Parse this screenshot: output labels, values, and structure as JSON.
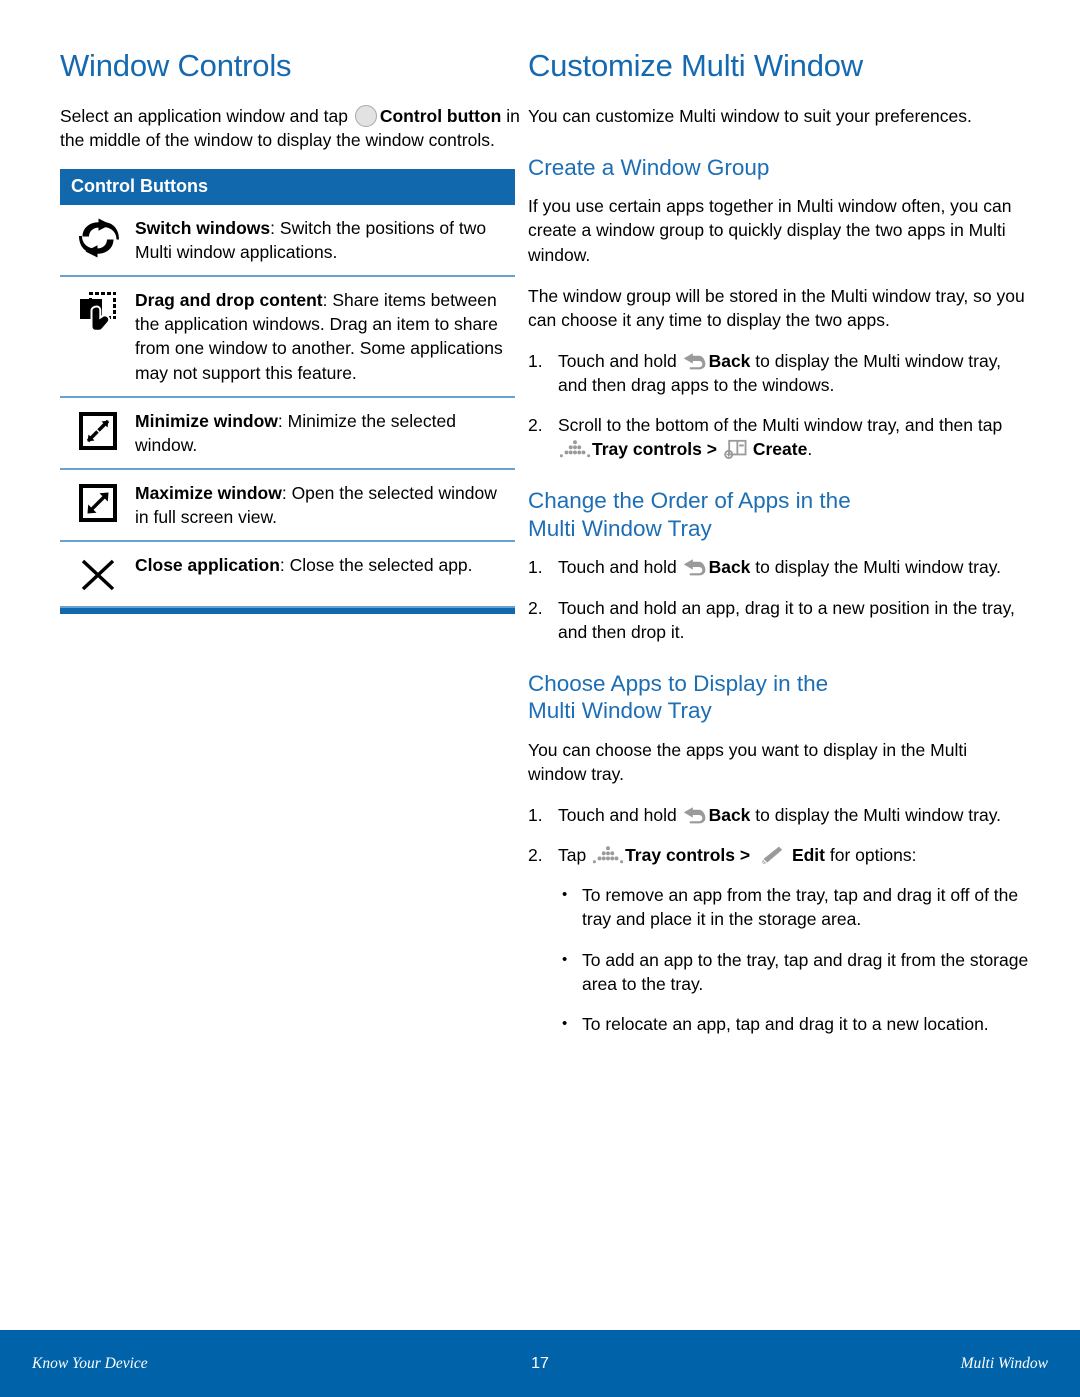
{
  "left_column": {
    "title": "Window Controls",
    "intro": {
      "part1": "Select an application window and tap ",
      "icon": "control-button-circle-icon",
      "bold1": "Control button",
      "part2": " in the middle of the window to display the window controls."
    },
    "table": {
      "header": "Control Buttons",
      "rows": [
        {
          "icon": "switch-windows-icon",
          "term": "Switch windows",
          "separator": ": ",
          "description": "Switch the positions of two Multi window applications."
        },
        {
          "icon": "drag-and-drop-icon",
          "term": "Drag and drop content",
          "separator": ": ",
          "description": "Share items between the application windows. Drag an item to share from one window to another. Some applications may not support this feature."
        },
        {
          "icon": "minimize-window-icon",
          "term": "Minimize window",
          "separator": ": ",
          "description": "Minimize the selected window."
        },
        {
          "icon": "maximize-window-icon",
          "term": "Maximize window",
          "separator": ": ",
          "description": "Open the selected window in full screen view."
        },
        {
          "icon": "close-application-icon",
          "term": "Close application",
          "separator": ": ",
          "description": "Close the selected app."
        }
      ]
    }
  },
  "right_column": {
    "title": "Customize Multi Window",
    "intro": "You can customize Multi window to suit your preferences.",
    "section_create": {
      "heading": "Create a Window Group",
      "para1": "If you use certain apps together in Multi window often, you can create a window group to quickly display the two apps in Multi window.",
      "para2": "The window group will be stored in the Multi window tray, so you can choose it any time to display the two apps.",
      "steps": [
        {
          "number": "1.",
          "pre": "Touch and hold ",
          "icon": "back-icon",
          "bold": "Back",
          "post": " to display the Multi window tray, and then drag apps to the windows."
        },
        {
          "number": "2.",
          "pre": "Scroll to the bottom of the Multi window tray, and then tap ",
          "icon1": "tray-controls-dots-icon",
          "bold1": "Tray controls",
          "mid": " > ",
          "icon2": "create-icon",
          "bold2": "Create",
          "post": "."
        }
      ]
    },
    "section_order": {
      "heading_line1": "Change the Order of Apps in the",
      "heading_line2": "Multi Window Tray",
      "steps": [
        {
          "number": "1.",
          "pre": "Touch and hold ",
          "icon": "back-icon",
          "bold": "Back",
          "post": " to display the Multi window tray."
        },
        {
          "number": "2.",
          "text": "Touch and hold an app, drag it to a new position in the tray, and then drop it."
        }
      ]
    },
    "section_choose": {
      "heading_line1": "Choose Apps to Display in the",
      "heading_line2": "Multi Window Tray",
      "para1": "You can choose the apps you want to display in the Multi window tray.",
      "steps": [
        {
          "number": "1.",
          "pre": "Touch and hold ",
          "icon": "back-icon",
          "bold": "Back",
          "post": " to display the Multi window tray."
        },
        {
          "number": "2.",
          "pre": "Tap ",
          "icon1": "tray-controls-dots-icon",
          "bold1": "Tray controls",
          "mid": " > ",
          "icon2": "edit-pencil-icon",
          "bold2": "Edit",
          "post": " for options:"
        }
      ],
      "bullets": [
        "To remove an app from the tray, tap and drag it off of the tray and place it in the storage area.",
        "To add an app to the tray, tap and drag it from the storage area to the tray.",
        "To relocate an app, tap and drag it to a new location."
      ],
      "bullet_marker": "•"
    }
  },
  "footer": {
    "left": "Know Your Device",
    "page_number": "17",
    "right": "Multi Window"
  },
  "colors": {
    "heading_blue": "#1569b0",
    "section_blue": "#1d6eb4",
    "table_header_blue": "#1268ad",
    "table_rule_blue": "#6aa2cd",
    "footer_blue": "#0062a8",
    "icon_gray": "#9a9a9a"
  }
}
